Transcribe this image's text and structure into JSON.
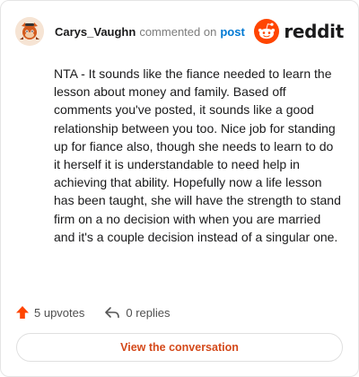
{
  "comment": {
    "author": "Carys_Vaughn",
    "action_text": "commented on",
    "target_link": "post",
    "body": "NTA - It sounds like the fiance needed to learn the lesson about money and family. Based off comments you've posted, it sounds like a good relationship between you too. Nice job for standing up for fiance also, though she needs to learn to do it herself it is understandable to need help in achieving that ability. Hopefully now a life lesson has been taught, she will have the strength to stand firm on a no decision with when you are married and it's a couple decision instead of a singular one."
  },
  "brand": {
    "wordmark": "reddit",
    "logo_icon": "reddit-snoo-icon",
    "color": "#ff4500"
  },
  "stats": {
    "upvotes": "5 upvotes",
    "upvote_icon": "upvote-arrow-icon",
    "upvote_color": "#ff4500",
    "replies": "0 replies",
    "reply_icon": "reply-arrow-icon"
  },
  "cta": {
    "label": "View the conversation",
    "color": "#d4491a"
  },
  "colors": {
    "link": "#0079d3",
    "text": "#1a1a1b",
    "muted": "#7c7c7c"
  }
}
